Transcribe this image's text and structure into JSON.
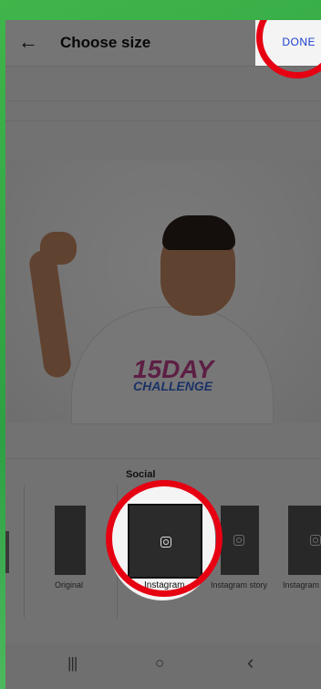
{
  "header": {
    "back_icon": "arrow-left-icon",
    "title": "Choose size",
    "done_label": "DONE"
  },
  "photo": {
    "shirt_logo_line1": "15DAY",
    "shirt_logo_line2": "CHALLENGE"
  },
  "sizes": {
    "section_label": "Social",
    "items": [
      {
        "label": "Original",
        "selected": false
      },
      {
        "label": "Instagram",
        "selected": true,
        "icon": "instagram-icon"
      },
      {
        "label": "Instagram story",
        "selected": false,
        "icon": "instagram-icon"
      },
      {
        "label": "Instagram",
        "selected": false,
        "icon": "instagram-icon"
      }
    ]
  },
  "nav": {
    "recent_icon": "recent-apps-icon",
    "home_icon": "home-icon",
    "back_icon": "nav-back-icon",
    "recent_glyph": "|||",
    "home_glyph": "○",
    "back_glyph": "‹"
  },
  "colors": {
    "highlight_ring": "#e60012",
    "accent": "#1a3fd1",
    "background": "#2ea043"
  }
}
